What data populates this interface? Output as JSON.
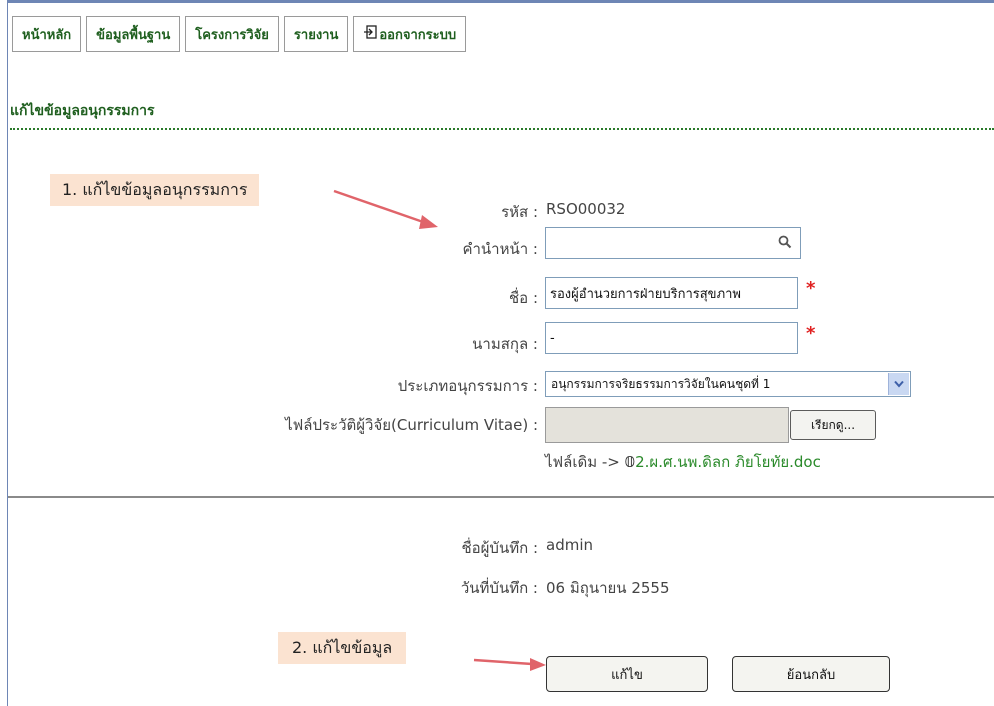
{
  "nav": {
    "items": [
      {
        "label": "หน้าหลัก"
      },
      {
        "label": "ข้อมูลพื้นฐาน"
      },
      {
        "label": "โครงการวิจัย"
      },
      {
        "label": "รายงาน"
      },
      {
        "label": "ออกจากระบบ"
      }
    ]
  },
  "page": {
    "title": "แก้ไขข้อมูลอนุกรรมการ"
  },
  "callouts": {
    "step1": "1. แก้ไขข้อมูลอนุกรรมการ",
    "step2": "2. แก้ไขข้อมูล"
  },
  "form": {
    "code_label": "รหัส :",
    "code_value": "RSO00032",
    "prefix_label": "คำนำหน้า :",
    "prefix_value": "",
    "name_label": "ชื่อ :",
    "name_value": "รองผู้อำนวยการฝ่ายบริการสุขภาพ",
    "surname_label": "นามสกุล :",
    "surname_value": "-",
    "type_label": "ประเภทอนุกรรมการ :",
    "type_value": "อนุกรรมการจริยธรรมการวิจัยในคนชุดที่ 1",
    "cv_label": "ไฟล์ประวัติผู้วิจัย(Curriculum Vitae) :",
    "browse_label": "เรียกดู...",
    "old_file_prefix": "ไฟล์เดิม ->",
    "old_file_name": "2.ผ.ศ.นพ.ดิลก ภิยโยทัย.doc",
    "required_mark": "*"
  },
  "record": {
    "recorder_label": "ชื่อผู้บันทึก :",
    "recorder_value": "admin",
    "date_label": "วันที่บันทึก :",
    "date_value": "06 มิถุนายน 2555"
  },
  "buttons": {
    "edit": "แก้ไข",
    "back": "ย้อนกลับ"
  },
  "colors": {
    "accent_green": "#1f5f1f",
    "callout_bg": "#fbe3d1",
    "arrow": "#e0646a",
    "required": "#e02020"
  }
}
